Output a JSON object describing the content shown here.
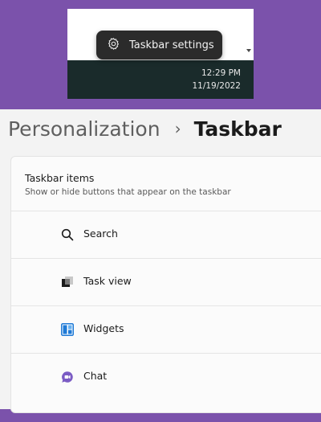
{
  "taskbar": {
    "time": "12:29 PM",
    "date": "11/19/2022",
    "context_menu": {
      "label": "Taskbar settings",
      "icon": "gear-icon"
    }
  },
  "settings": {
    "breadcrumb": {
      "parent": "Personalization",
      "separator": "›",
      "current": "Taskbar"
    },
    "taskbar_items": {
      "title": "Taskbar items",
      "subtitle": "Show or hide buttons that appear on the taskbar",
      "items": [
        {
          "label": "Search",
          "icon": "search-icon"
        },
        {
          "label": "Task view",
          "icon": "task-view-icon"
        },
        {
          "label": "Widgets",
          "icon": "widgets-icon"
        },
        {
          "label": "Chat",
          "icon": "chat-icon"
        }
      ]
    }
  },
  "colors": {
    "desktop_background": "#7b52ab",
    "taskbar": "#1a2b2b",
    "context_menu": "#2b2b2b",
    "settings_background": "#f3f3f3",
    "card_background": "#fbfbfb",
    "widgets_accent": "#1f7ad6",
    "chat_accent": "#7b5cc4"
  }
}
